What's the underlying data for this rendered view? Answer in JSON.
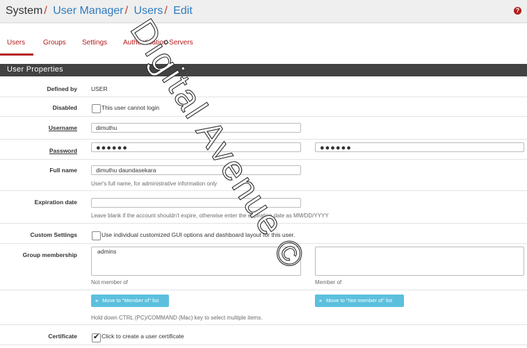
{
  "breadcrumb": {
    "root": "System",
    "items": [
      "User Manager",
      "Users",
      "Edit"
    ],
    "sep": "/"
  },
  "help_icon": "?",
  "tabs": [
    "Users",
    "Groups",
    "Settings",
    "Authentication Servers"
  ],
  "panel_title": "User Properties",
  "fields": {
    "defined_by": {
      "label": "Defined by",
      "value": "USER"
    },
    "disabled": {
      "label": "Disabled",
      "checkbox_label": "This user cannot login",
      "checked": false
    },
    "username": {
      "label": "Username",
      "value": "dimuthu"
    },
    "password": {
      "label": "Password",
      "value": "●●●●●●",
      "confirm": "●●●●●●"
    },
    "full_name": {
      "label": "Full name",
      "value": "dimuthu daundasekara",
      "help": "User's full name, for administrative information only"
    },
    "expiration": {
      "label": "Expiration date",
      "value": "",
      "help": "Leave blank if the account shouldn't expire, otherwise enter the expiration date as MM/DD/YYYY"
    },
    "custom_settings": {
      "label": "Custom Settings",
      "checkbox_label": "Use individual customized GUI options and dashboard layout for this user.",
      "checked": false
    },
    "group_membership": {
      "label": "Group membership",
      "not_member_options": [
        "admins"
      ],
      "not_member_caption": "Not member of",
      "member_caption": "Member of"
    },
    "move_buttons": {
      "to_member": "Move to \"Member of\" list",
      "to_not_member": "Move to \"Not member of\" list",
      "hint": "Hold down CTRL (PC)/COMMAND (Mac) key to select multiple items."
    },
    "certificate": {
      "label": "Certificate",
      "checkbox_label": "Click to create a user certificate",
      "checked": true
    }
  },
  "watermark": "Digital Avenue ©",
  "colors": {
    "accent": "#b31b1b",
    "link": "#2f7bbf",
    "panel_head": "#424242",
    "info_button": "#5bc0de"
  }
}
